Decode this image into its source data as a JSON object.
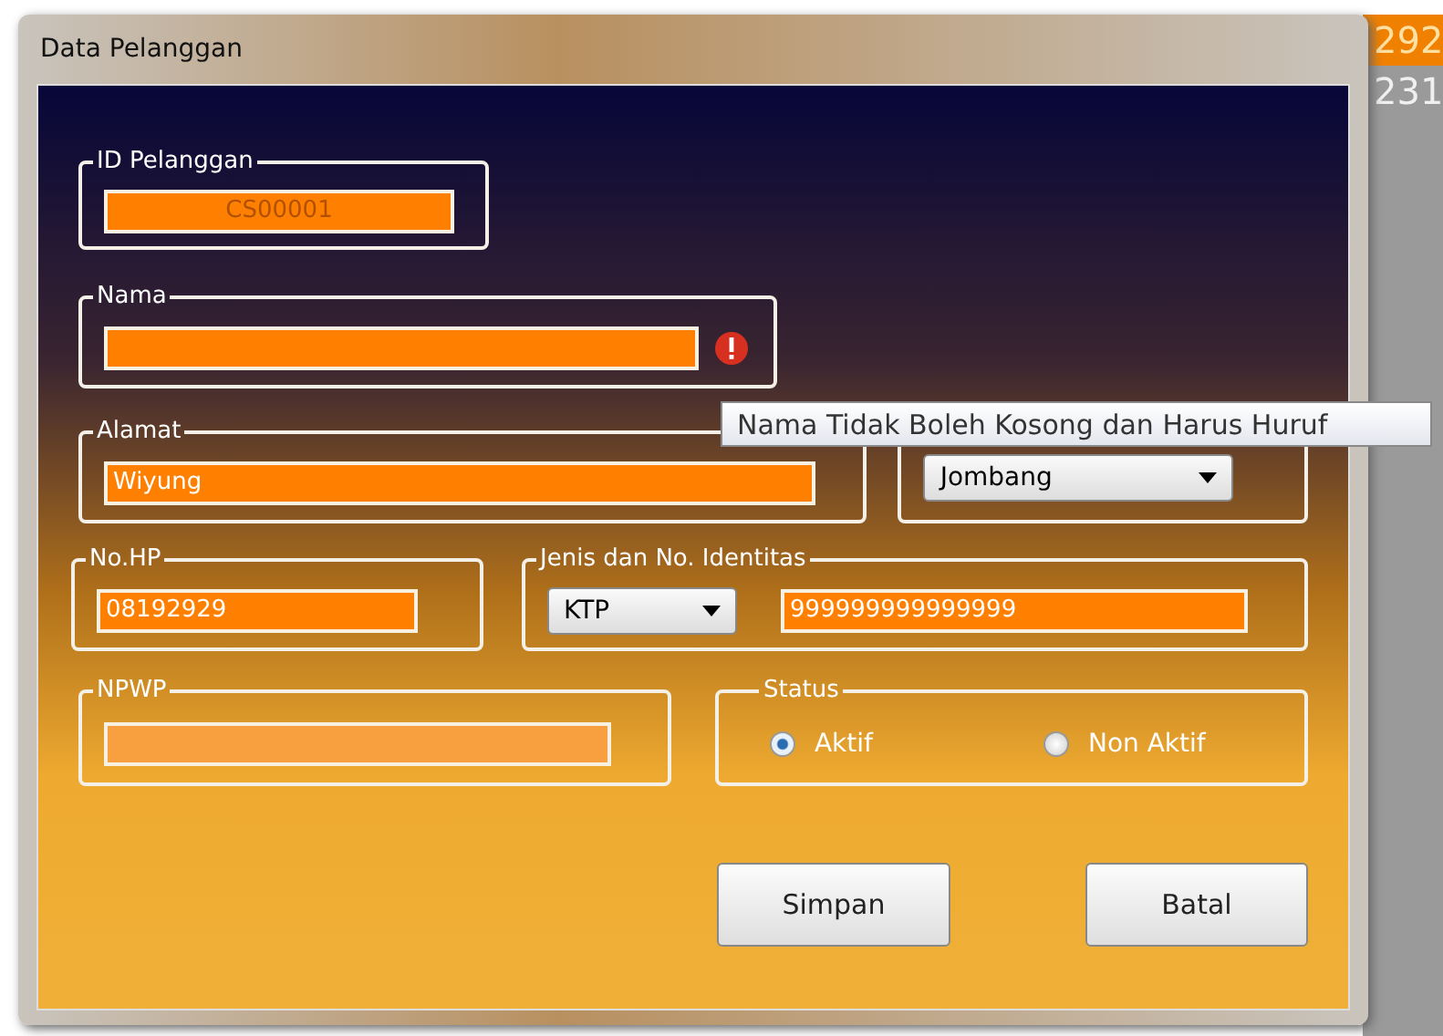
{
  "background": {
    "texts": [
      "292",
      "231"
    ]
  },
  "window": {
    "title": "Data Pelanggan"
  },
  "id_pelanggan": {
    "label": "ID Pelanggan",
    "value": "CS00001"
  },
  "nama": {
    "label": "Nama",
    "error": true,
    "tooltip": "Nama Tidak Boleh Kosong dan Harus Huruf"
  },
  "alamat": {
    "label": "Alamat",
    "value": "Wiyung"
  },
  "kota": {
    "value": "Jombang"
  },
  "no_hp": {
    "label": "No.HP",
    "value": "08192929"
  },
  "identitas": {
    "label": "Jenis dan No. Identitas",
    "type": "KTP",
    "value": "999999999999999"
  },
  "npwp": {
    "label": "NPWP"
  },
  "status": {
    "label": "Status",
    "options": [
      {
        "label": "Aktif",
        "selected": true
      },
      {
        "label": "Non Aktif",
        "selected": false
      }
    ]
  },
  "buttons": [
    "Simpan",
    "Batal"
  ]
}
